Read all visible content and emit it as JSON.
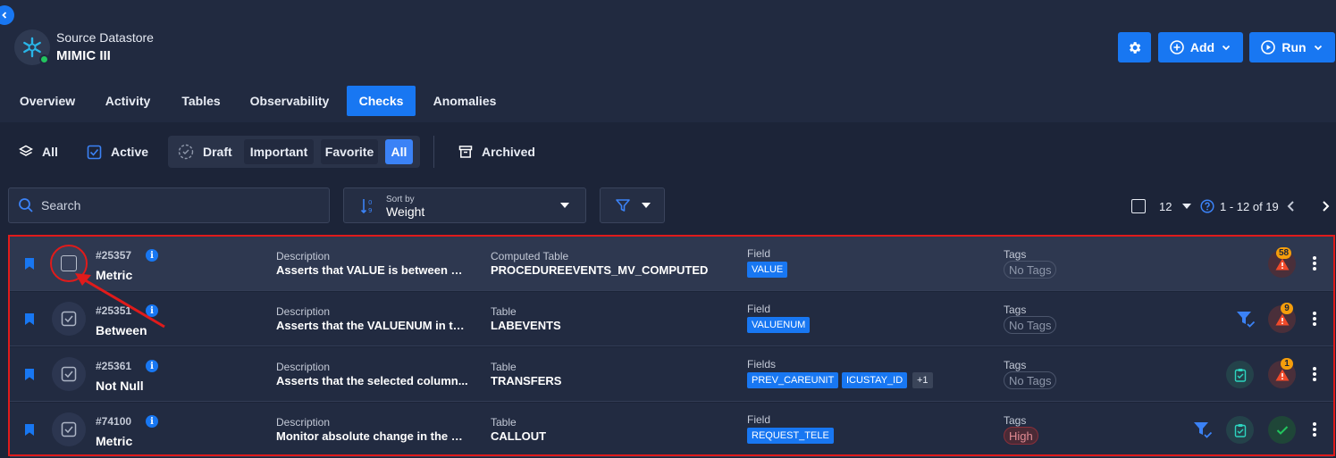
{
  "datastore": {
    "type_label": "Source Datastore",
    "name": "MIMIC III"
  },
  "header_buttons": {
    "add_label": "Add",
    "run_label": "Run"
  },
  "tabs": [
    "Overview",
    "Activity",
    "Tables",
    "Observability",
    "Checks",
    "Anomalies"
  ],
  "active_tab": "Checks",
  "status_filters": {
    "all": "All",
    "active": "Active",
    "draft": "Draft",
    "important": "Important",
    "favorite": "Favorite",
    "all_segment": "All",
    "archived": "Archived"
  },
  "search": {
    "placeholder": "Search"
  },
  "sort": {
    "caption": "Sort by",
    "value": "Weight"
  },
  "pagination": {
    "page_size": "12",
    "range": "1 - 12 of 19"
  },
  "checks": [
    {
      "id": "#25357",
      "type": "Metric",
      "desc_label": "Description",
      "description": "Asserts that VALUE is between MI...",
      "table_label": "Computed Table",
      "table": "PROCEDUREEVENTS_MV_COMPUTED",
      "field_label": "Field",
      "fields": [
        "VALUE"
      ],
      "tags_label": "Tags",
      "tag": "No Tags",
      "anomaly_count": "58"
    },
    {
      "id": "#25351",
      "type": "Between",
      "desc_label": "Description",
      "description": "Asserts that the VALUENUM in th...",
      "table_label": "Table",
      "table": "LABEVENTS",
      "field_label": "Field",
      "fields": [
        "VALUENUM"
      ],
      "tags_label": "Tags",
      "tag": "No Tags",
      "anomaly_count": "9"
    },
    {
      "id": "#25361",
      "type": "Not Null",
      "desc_label": "Description",
      "description": "Asserts that the selected column...",
      "table_label": "Table",
      "table": "TRANSFERS",
      "field_label": "Fields",
      "fields": [
        "PREV_CAREUNIT",
        "ICUSTAY_ID"
      ],
      "more_fields": "+1",
      "tags_label": "Tags",
      "tag": "No Tags",
      "anomaly_count": "1"
    },
    {
      "id": "#74100",
      "type": "Metric",
      "desc_label": "Description",
      "description": "Monitor absolute change in the m...",
      "table_label": "Table",
      "table": "CALLOUT",
      "field_label": "Field",
      "fields": [
        "REQUEST_TELE"
      ],
      "tags_label": "Tags",
      "tag": "High"
    }
  ],
  "colors": {
    "accent": "#1877f2",
    "highlight_border": "#e01b1b",
    "warning": "#f59e0b",
    "success": "#22c55e"
  }
}
